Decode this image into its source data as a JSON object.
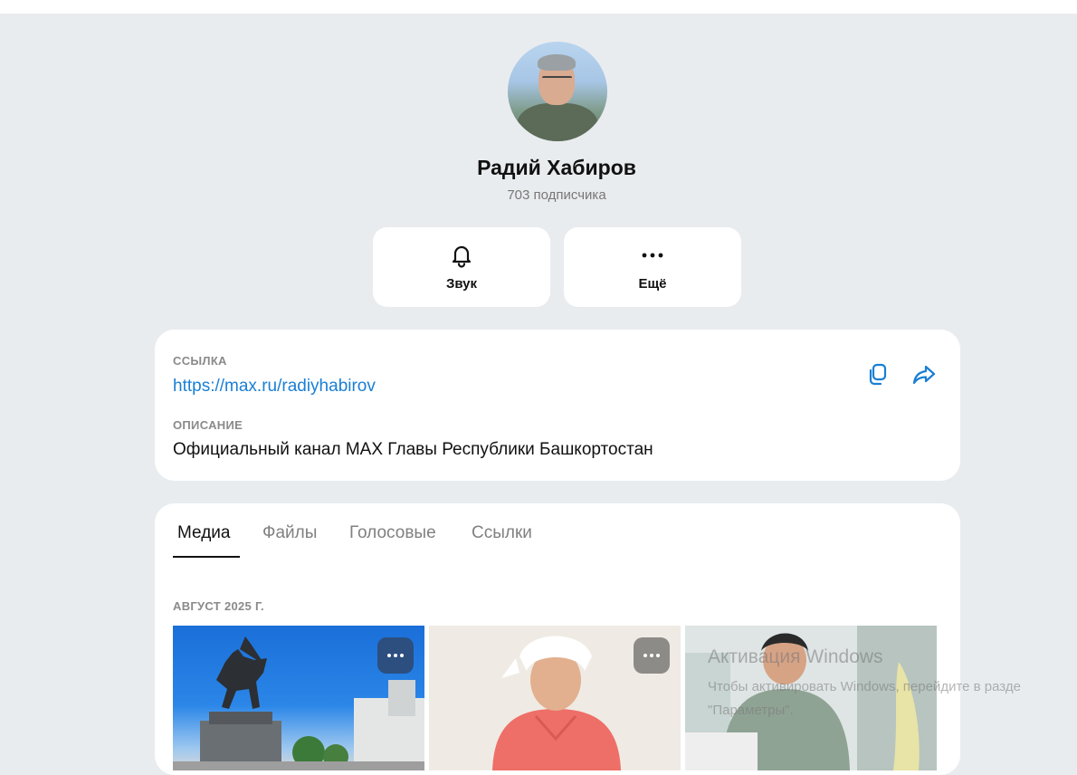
{
  "profile": {
    "name": "Радий Хабиров",
    "subscribers": "703 подписчика"
  },
  "actions": {
    "sound_label": "Звук",
    "more_label": "Ещё"
  },
  "info": {
    "link_label": "ССЫЛКА",
    "link_url": "https://max.ru/radiyhabirov",
    "description_label": "ОПИСАНИЕ",
    "description": "Официальный канал MAX Главы Республики Башкортостан"
  },
  "media": {
    "tabs": [
      {
        "label": "Медиа",
        "active": true
      },
      {
        "label": "Файлы",
        "active": false
      },
      {
        "label": "Голосовые",
        "active": false
      },
      {
        "label": "Ссылки",
        "active": false
      }
    ],
    "month": "АВГУСТ 2025 Г.",
    "thumbnails": [
      "photo-monument",
      "photo-nurse",
      "photo-hospital"
    ]
  },
  "watermark": {
    "title": "Активация Windows",
    "line1": "Чтобы активировать Windows, перейдите в разде",
    "line2": "\"Параметры\"."
  },
  "colors": {
    "background": "#e9ecef",
    "card": "#ffffff",
    "link": "#1a7fd4",
    "muted": "#8a8a8a"
  }
}
